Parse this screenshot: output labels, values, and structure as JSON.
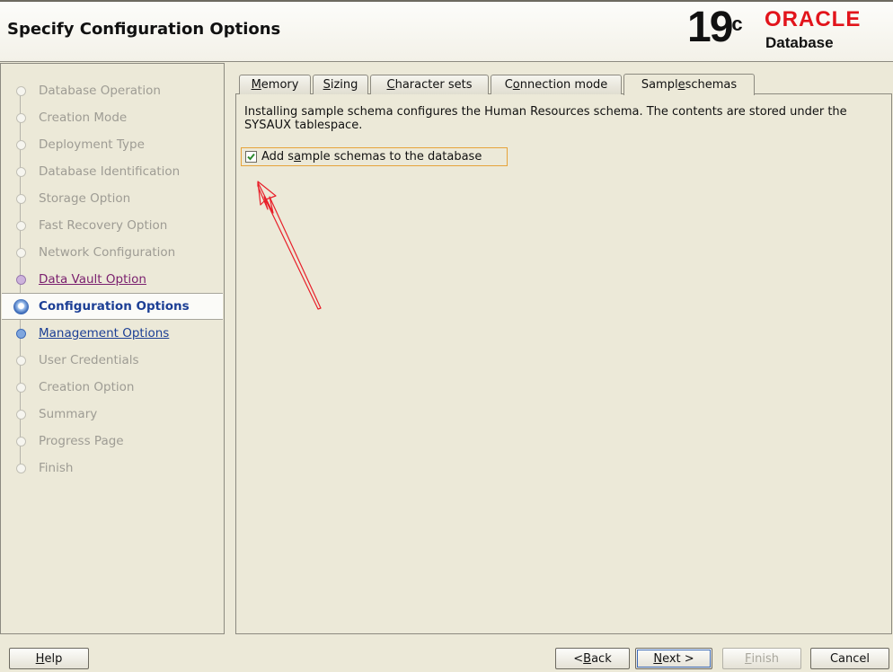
{
  "header": {
    "title": "Specify Configuration Options",
    "brand_version": "19",
    "brand_version_sup": "c",
    "brand_logo": "ORACLE",
    "brand_product": "Database"
  },
  "nav": {
    "items": [
      {
        "label": "Database Operation",
        "state": "disabled"
      },
      {
        "label": "Creation Mode",
        "state": "disabled"
      },
      {
        "label": "Deployment Type",
        "state": "disabled"
      },
      {
        "label": "Database Identification",
        "state": "disabled"
      },
      {
        "label": "Storage Option",
        "state": "disabled"
      },
      {
        "label": "Fast Recovery Option",
        "state": "disabled"
      },
      {
        "label": "Network Configuration",
        "state": "disabled"
      },
      {
        "label": "Data Vault Option",
        "state": "visited"
      },
      {
        "label": "Configuration Options",
        "state": "current"
      },
      {
        "label": "Management Options",
        "state": "link"
      },
      {
        "label": "User Credentials",
        "state": "disabled"
      },
      {
        "label": "Creation Option",
        "state": "disabled"
      },
      {
        "label": "Summary",
        "state": "disabled"
      },
      {
        "label": "Progress Page",
        "state": "disabled"
      },
      {
        "label": "Finish",
        "state": "disabled"
      }
    ]
  },
  "tabs": [
    {
      "pre": "",
      "u": "M",
      "post": "emory"
    },
    {
      "pre": "",
      "u": "S",
      "post": "izing"
    },
    {
      "pre": "",
      "u": "C",
      "post": "haracter sets"
    },
    {
      "pre": "C",
      "u": "o",
      "post": "nnection mode"
    },
    {
      "pre": "Sampl",
      "u": "e",
      "post": " schemas"
    }
  ],
  "active_tab": "Sample schemas",
  "sample_schemas": {
    "description": "Installing sample schema configures the Human Resources schema. The contents are stored under the SYSAUX tablespace.",
    "checkbox_pre": "Add s",
    "checkbox_u": "a",
    "checkbox_post": "mple schemas to the database",
    "checked": true
  },
  "annotation_color": "#e8202a",
  "buttons": {
    "help": {
      "pre": "",
      "u": "H",
      "post": "elp"
    },
    "back": {
      "pre": "< ",
      "u": "B",
      "post": "ack"
    },
    "next": {
      "pre": "",
      "u": "N",
      "post": "ext >"
    },
    "finish": {
      "pre": "",
      "u": "F",
      "post": "inish"
    },
    "cancel": "Cancel"
  }
}
